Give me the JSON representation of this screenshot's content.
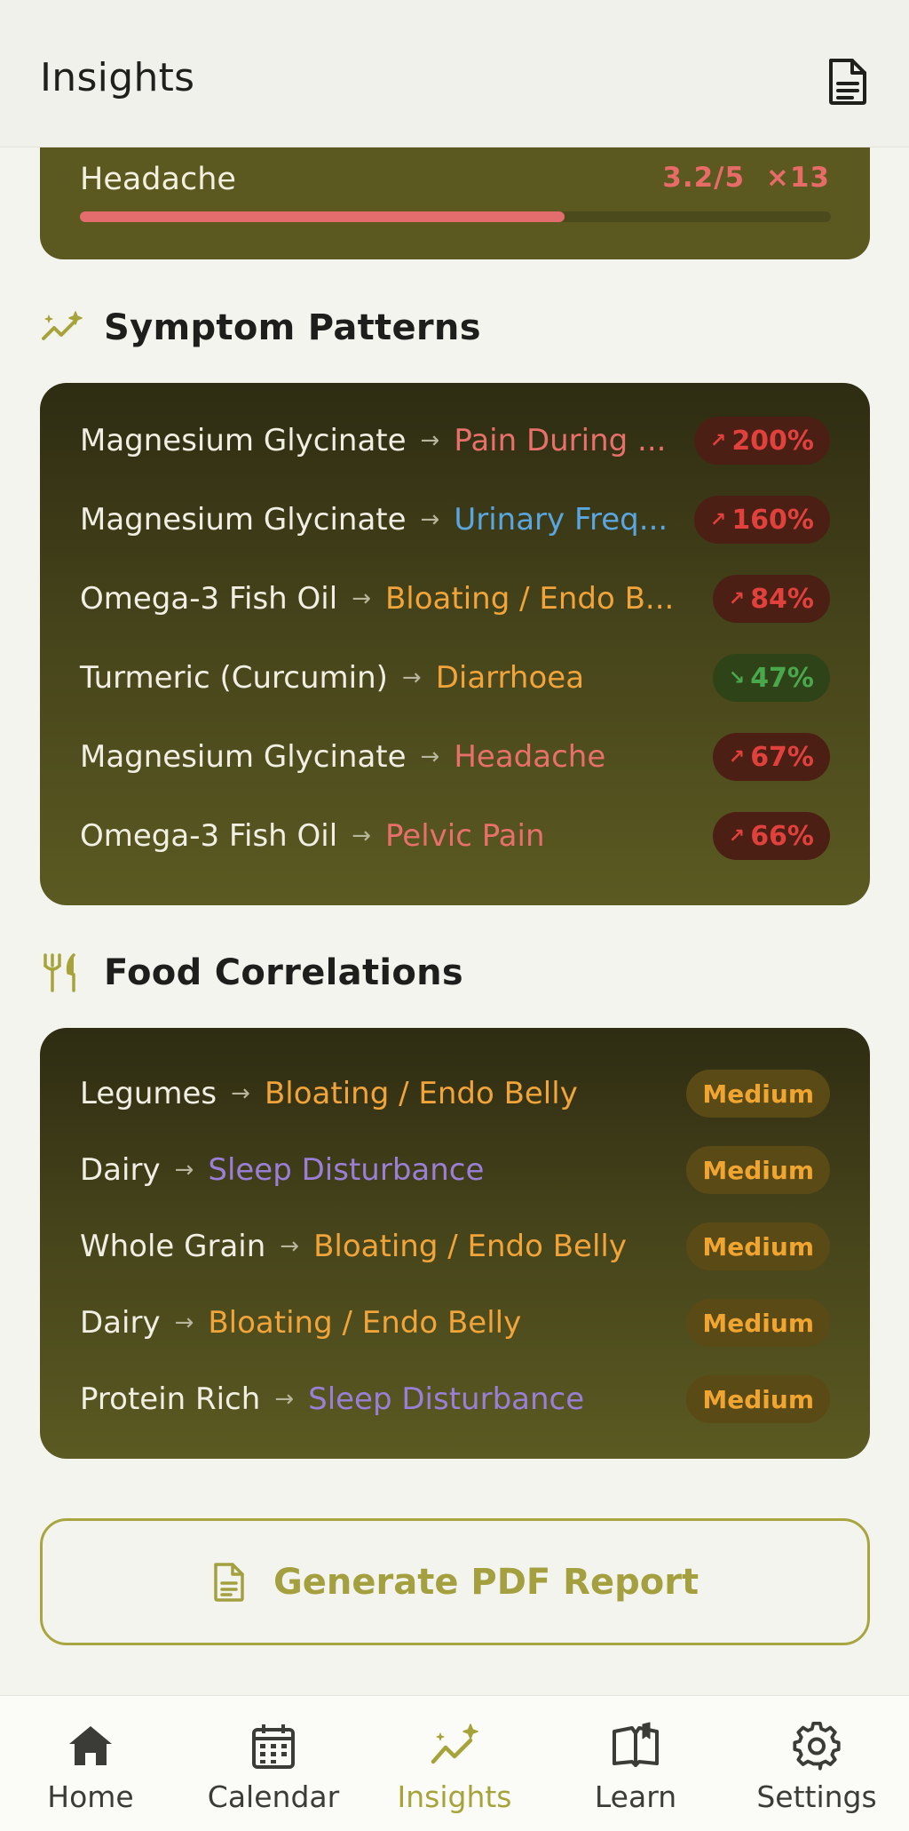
{
  "header": {
    "title": "Insights",
    "icon": "document-icon"
  },
  "top_item": {
    "name": "Headache",
    "score": "3.2/5",
    "count": "×13",
    "severity_fraction": 0.645
  },
  "symptom_patterns": {
    "title": "Symptom Patterns",
    "rows": [
      {
        "source": "Magnesium Glycinate",
        "target": "Pain During ...",
        "target_color": "#e8706a",
        "trend": "up",
        "change": "200%"
      },
      {
        "source": "Magnesium Glycinate",
        "target": "Urinary Freq...",
        "target_color": "#5aa6e0",
        "trend": "up",
        "change": "160%"
      },
      {
        "source": "Omega-3 Fish Oil",
        "target": "Bloating / Endo B...",
        "target_color": "#f1a43a",
        "trend": "up",
        "change": "84%"
      },
      {
        "source": "Turmeric (Curcumin)",
        "target": "Diarrhoea",
        "target_color": "#f1a43a",
        "trend": "down",
        "change": "47%"
      },
      {
        "source": "Magnesium Glycinate",
        "target": "Headache",
        "target_color": "#e8706a",
        "trend": "up",
        "change": "67%"
      },
      {
        "source": "Omega-3 Fish Oil",
        "target": "Pelvic Pain",
        "target_color": "#e8706a",
        "trend": "up",
        "change": "66%"
      }
    ]
  },
  "food_correlations": {
    "title": "Food Correlations",
    "rows": [
      {
        "source": "Legumes",
        "target": "Bloating / Endo Belly",
        "target_color": "#f1a43a",
        "level": "Medium"
      },
      {
        "source": "Dairy",
        "target": "Sleep Disturbance",
        "target_color": "#9b7fd6",
        "level": "Medium"
      },
      {
        "source": "Whole Grain",
        "target": "Bloating / Endo Belly",
        "target_color": "#f1a43a",
        "level": "Medium"
      },
      {
        "source": "Dairy",
        "target": "Bloating / Endo Belly",
        "target_color": "#f1a43a",
        "level": "Medium"
      },
      {
        "source": "Protein Rich",
        "target": "Sleep Disturbance",
        "target_color": "#9b7fd6",
        "level": "Medium"
      }
    ]
  },
  "pdf_button": {
    "label": "Generate PDF Report"
  },
  "tabs": [
    {
      "label": "Home",
      "icon": "home-icon",
      "active": false
    },
    {
      "label": "Calendar",
      "icon": "calendar-icon",
      "active": false
    },
    {
      "label": "Insights",
      "icon": "insights-icon",
      "active": true
    },
    {
      "label": "Learn",
      "icon": "book-icon",
      "active": false
    },
    {
      "label": "Settings",
      "icon": "gear-icon",
      "active": false
    }
  ],
  "colors": {
    "accent": "#a7a33b",
    "card_dark": "#2e2c12",
    "card_light": "#5b5a22"
  }
}
